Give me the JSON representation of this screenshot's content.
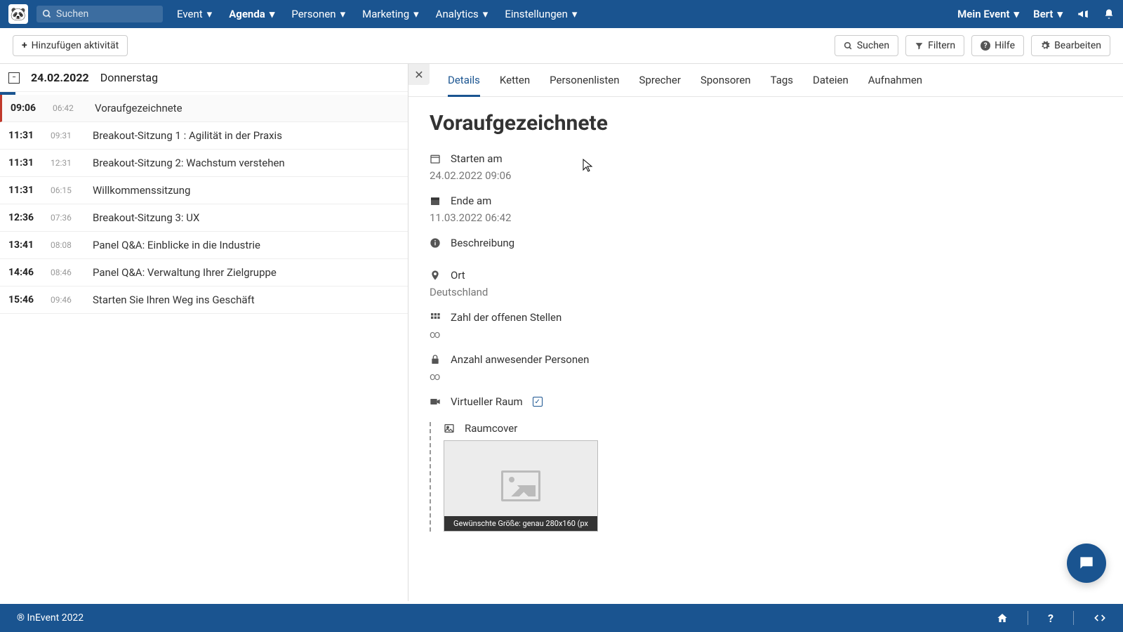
{
  "search_placeholder": "Suchen",
  "nav": {
    "event": "Event",
    "agenda": "Agenda",
    "people": "Personen",
    "marketing": "Marketing",
    "analytics": "Analytics",
    "settings": "Einstellungen",
    "myevent": "Mein Event",
    "user": "Bert"
  },
  "toolbar": {
    "add": "Hinzufügen aktivität",
    "search": "Suchen",
    "filter": "Filtern",
    "help": "Hilfe",
    "edit": "Bearbeiten"
  },
  "day": {
    "date": "24.02.2022",
    "dow": "Donnerstag"
  },
  "rows": [
    {
      "start": "09:06",
      "dur": "06:42",
      "title": "Voraufgezeichnete",
      "sel": true
    },
    {
      "start": "11:31",
      "dur": "09:31",
      "title": "Breakout-Sitzung 1 : Agilität in der Praxis"
    },
    {
      "start": "11:31",
      "dur": "12:31",
      "title": "Breakout-Sitzung 2: Wachstum verstehen"
    },
    {
      "start": "11:31",
      "dur": "06:15",
      "title": "Willkommenssitzung"
    },
    {
      "start": "12:36",
      "dur": "07:36",
      "title": "Breakout-Sitzung 3: UX"
    },
    {
      "start": "13:41",
      "dur": "08:08",
      "title": "Panel Q&A: Einblicke in die Industrie"
    },
    {
      "start": "14:46",
      "dur": "08:46",
      "title": "Panel Q&A: Verwaltung Ihrer Zielgruppe"
    },
    {
      "start": "15:46",
      "dur": "09:46",
      "title": "Starten Sie Ihren Weg ins Geschäft"
    }
  ],
  "tabs": {
    "details": "Details",
    "chains": "Ketten",
    "lists": "Personenlisten",
    "speakers": "Sprecher",
    "sponsors": "Sponsoren",
    "tags": "Tags",
    "files": "Dateien",
    "recordings": "Aufnahmen"
  },
  "detail": {
    "title": "Voraufgezeichnete",
    "start_label": "Starten am",
    "start_value": "24.02.2022 09:06",
    "end_label": "Ende am",
    "end_value": "11.03.2022 06:42",
    "desc_label": "Beschreibung",
    "place_label": "Ort",
    "place_value": "Deutschland",
    "vacancies_label": "Zahl der offenen Stellen",
    "vacancies_value": "∞",
    "attendees_label": "Anzahl anwesender Personen",
    "attendees_value": "∞",
    "virtual_label": "Virtueller Raum",
    "cover_label": "Raumcover",
    "cover_hint": "Gewünschte Größe: genau 280x160 (px"
  },
  "footer": {
    "copy": "® InEvent 2022"
  }
}
